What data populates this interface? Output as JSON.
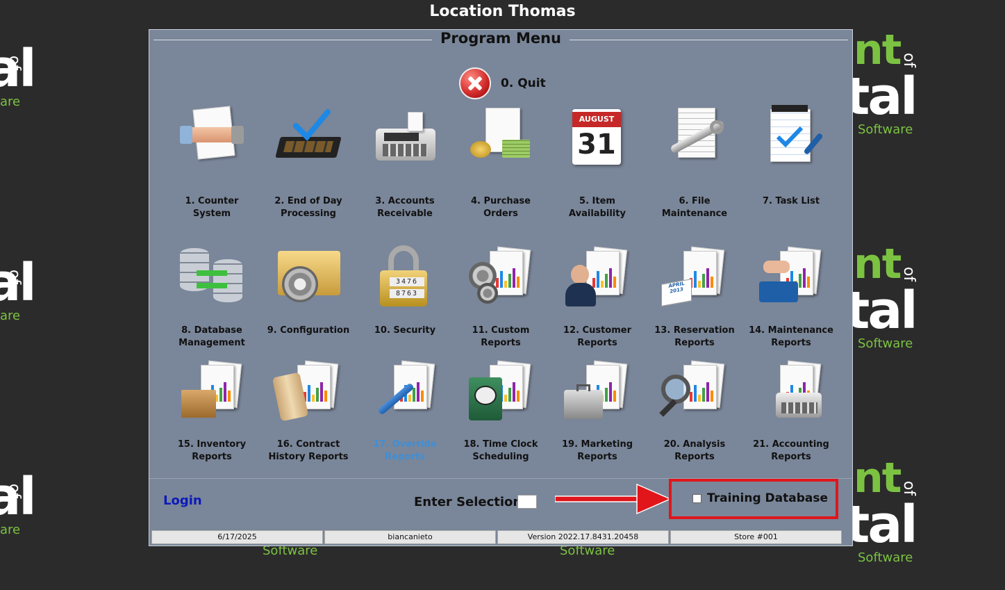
{
  "window_title": "Location Thomas",
  "menu_title": "Program Menu",
  "quit": {
    "label": "0. Quit"
  },
  "menu_items": [
    {
      "label": "1. Counter\nSystem",
      "icon": "handshake-contract-icon"
    },
    {
      "label": "2. End of Day\nProcessing",
      "icon": "cash-drawer-check-icon"
    },
    {
      "label": "3. Accounts\nReceivable",
      "icon": "adding-machine-icon"
    },
    {
      "label": "4. Purchase\nOrders",
      "icon": "money-invoice-icon"
    },
    {
      "label": "5. Item\nAvailability",
      "icon": "calendar-icon",
      "calendar": {
        "month": "AUGUST",
        "day": "31"
      }
    },
    {
      "label": "6. File\nMaintenance",
      "icon": "wrench-document-icon"
    },
    {
      "label": "7. Task List",
      "icon": "checklist-pen-icon"
    },
    {
      "label": "8. Database\nManagement",
      "icon": "database-sync-icon"
    },
    {
      "label": "9. Configuration",
      "icon": "folder-gear-icon"
    },
    {
      "label": "10. Security",
      "icon": "padlock-icon",
      "lock_digits": [
        "3476",
        "8763"
      ]
    },
    {
      "label": "11. Custom\nReports",
      "icon": "gears-report-icon"
    },
    {
      "label": "12. Customer\nReports",
      "icon": "person-report-icon"
    },
    {
      "label": "13. Reservation\nReports",
      "icon": "calendar-report-icon",
      "calendar_text": "APRIL 2013"
    },
    {
      "label": "14. Maintenance\nReports",
      "icon": "toolbox-report-icon"
    },
    {
      "label": "15. Inventory\nReports",
      "icon": "box-report-icon"
    },
    {
      "label": "16. Contract\nHistory Reports",
      "icon": "scroll-report-icon"
    },
    {
      "label": "17. Override\nReports",
      "icon": "screwdriver-report-icon",
      "disabled": true
    },
    {
      "label": "18. Time Clock\nScheduling",
      "icon": "time-clock-report-icon"
    },
    {
      "label": "19. Marketing\nReports",
      "icon": "briefcase-report-icon"
    },
    {
      "label": "20. Analysis\nReports",
      "icon": "magnifier-report-icon"
    },
    {
      "label": "21. Accounting\nReports",
      "icon": "calculator-report-icon"
    }
  ],
  "footer": {
    "login_label": "Login",
    "enter_selection_label": "Enter Selection",
    "enter_selection_value": "",
    "training_label": "Training Database",
    "training_checked": false
  },
  "status_bar": [
    "6/17/2025",
    "biancanieto",
    "Version 2022.17.8431.20458",
    "Store #001"
  ],
  "background_logo": {
    "word_fragment_1": "nt",
    "word_fragment_2": "tal",
    "of": "of",
    "tagline": "Software",
    "tagline_fragment": "are"
  },
  "colors": {
    "background": "#2b2b2b",
    "window": "#7a8699",
    "logo_green": "#7cc242",
    "highlight_red": "#e0161b",
    "login_blue": "#0c1ab8",
    "disabled_blue": "#3f8fd6"
  }
}
